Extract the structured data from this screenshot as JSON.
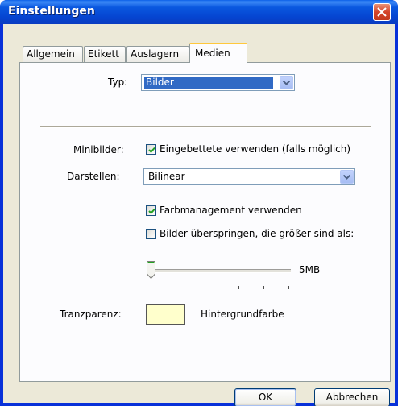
{
  "window": {
    "title": "Einstellungen",
    "close_icon": "close-icon"
  },
  "tabs": [
    {
      "label": "Allgemein",
      "active": false
    },
    {
      "label": "Etikett",
      "active": false
    },
    {
      "label": "Auslagern",
      "active": false
    },
    {
      "label": "Medien",
      "active": true
    }
  ],
  "medien": {
    "typ_label": "Typ:",
    "typ_value": "Bilder",
    "minibilder_label": "Minibilder:",
    "minibilder_checkbox": {
      "label": "Eingebettete verwenden (falls möglich)",
      "checked": true
    },
    "darstellen_label": "Darstellen:",
    "darstellen_value": "Bilinear",
    "farbmanagement_checkbox": {
      "label": "Farbmanagement verwenden",
      "checked": true
    },
    "skip_large_checkbox": {
      "label": "Bilder überspringen, die größer sind als:",
      "checked": false
    },
    "slider_value_label": "5MB",
    "slider_level": 0.0,
    "transparenz_label": "Tranzparenz:",
    "transparenz_color": "#ffffcc",
    "hintergrund_label": "Hintergrundfarbe"
  },
  "buttons": {
    "ok": "OK",
    "cancel": "Abbrechen"
  },
  "colors": {
    "titlebar": "#0545d1",
    "dialog_bg": "#ece9d8",
    "selection": "#316ac5",
    "check_green": "#21a121"
  }
}
